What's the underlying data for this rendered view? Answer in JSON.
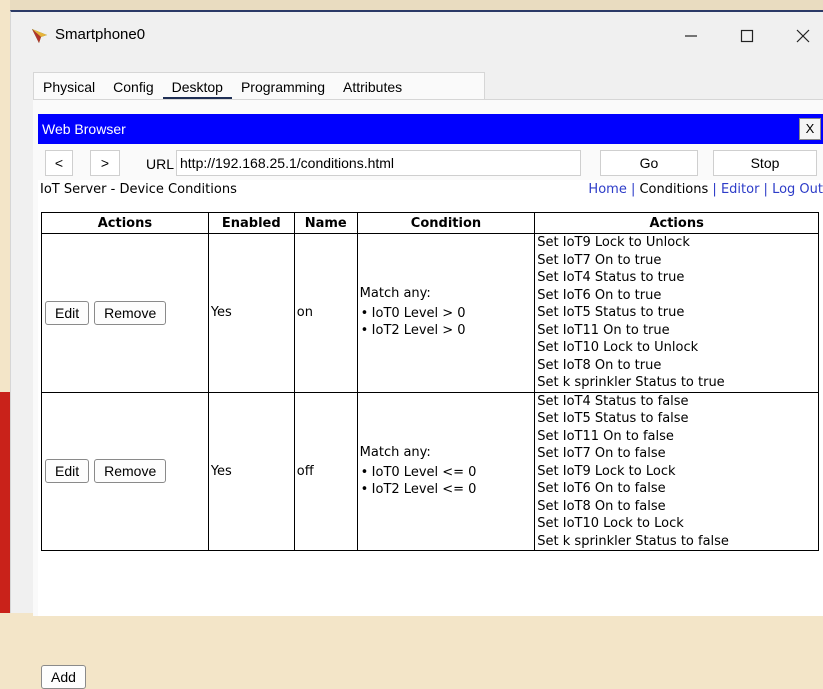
{
  "window": {
    "title": "Smartphone0",
    "controls": {
      "minimize": "—",
      "maximize": "☐",
      "close": "✕"
    }
  },
  "tabs": [
    {
      "label": "Physical",
      "active": false
    },
    {
      "label": "Config",
      "active": false
    },
    {
      "label": "Desktop",
      "active": true
    },
    {
      "label": "Programming",
      "active": false
    },
    {
      "label": "Attributes",
      "active": false
    }
  ],
  "web_browser": {
    "title": "Web Browser",
    "close_label": "X",
    "back_label": "<",
    "forward_label": ">",
    "url_label": "URL",
    "url_value": "http://192.168.25.1/conditions.html",
    "go_label": "Go",
    "stop_label": "Stop"
  },
  "page": {
    "title": "IoT Server - Device Conditions",
    "nav": {
      "home": "Home",
      "sep": " | ",
      "conditions": "Conditions",
      "editor": "Editor",
      "logout": "Log Out"
    },
    "table": {
      "headers": [
        "Actions",
        "Enabled",
        "Name",
        "Condition",
        "Actions"
      ],
      "rows": [
        {
          "edit_label": "Edit",
          "remove_label": "Remove",
          "enabled": "Yes",
          "name": "on",
          "condition_heading": "Match any:",
          "conditions": [
            "IoT0 Level > 0",
            "IoT2 Level > 0"
          ],
          "actions": [
            "Set IoT9 Lock to Unlock",
            "Set IoT7 On to true",
            "Set IoT4 Status to true",
            "Set IoT6 On to true",
            "Set IoT5 Status to true",
            "Set IoT11 On to true",
            "Set IoT10 Lock to Unlock",
            "Set IoT8 On to true",
            "Set k sprinkler Status to true"
          ]
        },
        {
          "edit_label": "Edit",
          "remove_label": "Remove",
          "enabled": "Yes",
          "name": "off",
          "condition_heading": "Match any:",
          "conditions": [
            "IoT0 Level <= 0",
            "IoT2 Level <= 0"
          ],
          "actions": [
            "Set IoT4 Status to false",
            "Set IoT5 Status to false",
            "Set IoT11 On to false",
            "Set IoT7 On to false",
            "Set IoT9 Lock to Lock",
            "Set IoT6 On to false",
            "Set IoT8 On to false",
            "Set IoT10 Lock to Lock",
            "Set k sprinkler Status to false"
          ]
        }
      ]
    },
    "add_label": "Add"
  },
  "colors": {
    "browser_title_bar": "#0000ff",
    "link": "#2d3cc8",
    "active_tab_underline": "#1f2f55",
    "desktop_accent": "#c9221a"
  }
}
